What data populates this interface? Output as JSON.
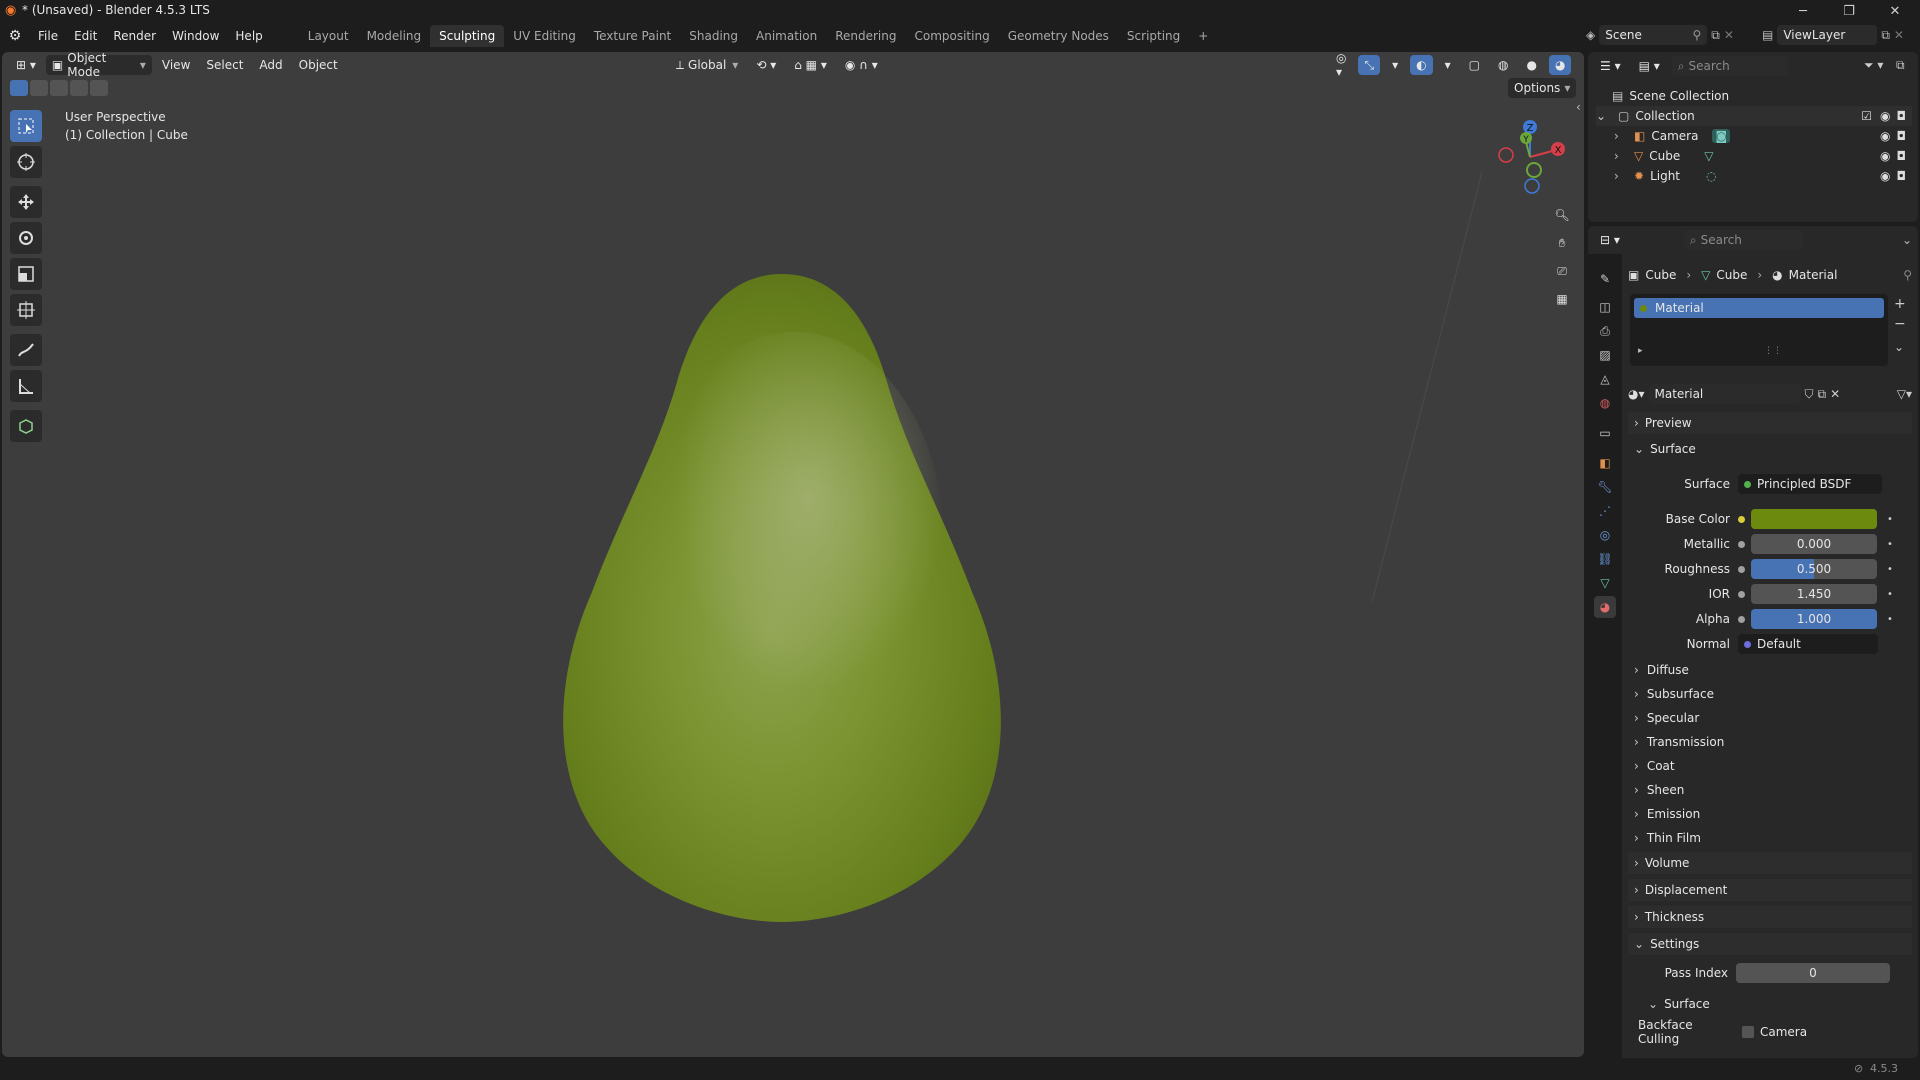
{
  "window": {
    "title": "* (Unsaved) - Blender 4.5.3 LTS",
    "minimize": "─",
    "maximize": "❐",
    "close": "✕"
  },
  "menus": [
    "File",
    "Edit",
    "Render",
    "Window",
    "Help"
  ],
  "workspaces": [
    "Layout",
    "Modeling",
    "Sculpting",
    "UV Editing",
    "Texture Paint",
    "Shading",
    "Animation",
    "Rendering",
    "Compositing",
    "Geometry Nodes",
    "Scripting"
  ],
  "active_workspace": "Sculpting",
  "add_workspace": "+",
  "scene": {
    "name": "Scene",
    "viewlayer": "ViewLayer"
  },
  "viewport": {
    "mode": "Object Mode",
    "menus": [
      "View",
      "Select",
      "Add",
      "Object"
    ],
    "orientation": "Global",
    "options_label": "Options",
    "overlay_line1": "User Perspective",
    "overlay_line2": "(1) Collection | Cube",
    "gizmo": {
      "z": "Z",
      "y": "Y",
      "x": "X"
    },
    "object_color": "#7b8f26"
  },
  "outliner": {
    "search_placeholder": "Search",
    "root": "Scene Collection",
    "collection": "Collection",
    "items": [
      {
        "name": "Camera"
      },
      {
        "name": "Cube"
      },
      {
        "name": "Light"
      }
    ]
  },
  "properties": {
    "search_placeholder": "Search",
    "breadcrumb": [
      "Cube",
      "Cube",
      "Material"
    ],
    "slot": "Material",
    "material_name": "Material",
    "panels": {
      "preview": "Preview",
      "surface": "Surface"
    },
    "surface": {
      "label": "Surface",
      "shader": "Principled BSDF",
      "base_color_label": "Base Color",
      "base_color": "#6b8a0e",
      "metallic_label": "Metallic",
      "metallic": "0.000",
      "metallic_fraction": 0.0,
      "roughness_label": "Roughness",
      "roughness": "0.500",
      "roughness_fraction": 0.5,
      "ior_label": "IOR",
      "ior": "1.450",
      "alpha_label": "Alpha",
      "alpha": "1.000",
      "alpha_fraction": 1.0,
      "normal_label": "Normal",
      "normal": "Default"
    },
    "subpanels": [
      "Diffuse",
      "Subsurface",
      "Specular",
      "Transmission",
      "Coat",
      "Sheen",
      "Emission",
      "Thin Film"
    ],
    "panels2": [
      "Volume",
      "Displacement",
      "Thickness"
    ],
    "settings": {
      "label": "Settings",
      "pass_index_label": "Pass Index",
      "pass_index": "0",
      "surface_label": "Surface",
      "backface_label": "Backface Culling",
      "camera_label": "Camera"
    }
  },
  "status": {
    "version": "4.5.3"
  }
}
